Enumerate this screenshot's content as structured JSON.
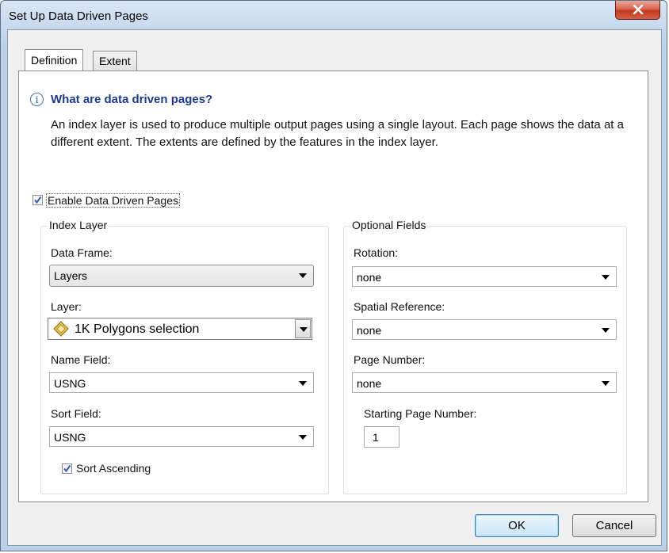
{
  "window": {
    "title": "Set Up Data Driven Pages"
  },
  "tabs": [
    {
      "label": "Definition",
      "active": true
    },
    {
      "label": "Extent",
      "active": false
    }
  ],
  "info": {
    "title": "What are data driven pages?",
    "text": "An index layer is used to produce multiple output pages using a single layout.  Each page shows the data at a different extent.  The extents are defined by the features in the index layer."
  },
  "enable": {
    "label": "Enable Data Driven Pages",
    "checked": true
  },
  "index_layer": {
    "group_label": "Index Layer",
    "data_frame": {
      "label": "Data Frame:",
      "value": "Layers"
    },
    "layer": {
      "label": "Layer:",
      "value": "1K Polygons selection"
    },
    "name_field": {
      "label": "Name Field:",
      "value": "USNG"
    },
    "sort_field": {
      "label": "Sort Field:",
      "value": "USNG"
    },
    "sort_ascending": {
      "label": "Sort Ascending",
      "checked": true
    }
  },
  "optional_fields": {
    "group_label": "Optional Fields",
    "rotation": {
      "label": "Rotation:",
      "value": "none"
    },
    "spatial_reference": {
      "label": "Spatial Reference:",
      "value": "none"
    },
    "page_number": {
      "label": "Page Number:",
      "value": "none"
    },
    "starting_page_number": {
      "label": "Starting Page Number:",
      "value": "1"
    }
  },
  "buttons": {
    "ok": "OK",
    "cancel": "Cancel"
  },
  "colors": {
    "accent": "#1d3b8c",
    "close": "#c3391f",
    "checkmark": "#3b5ea8"
  },
  "icons": {
    "info": "info-icon",
    "layer": "polygon-layer-icon",
    "close": "close-icon",
    "check": "checkmark-icon"
  }
}
